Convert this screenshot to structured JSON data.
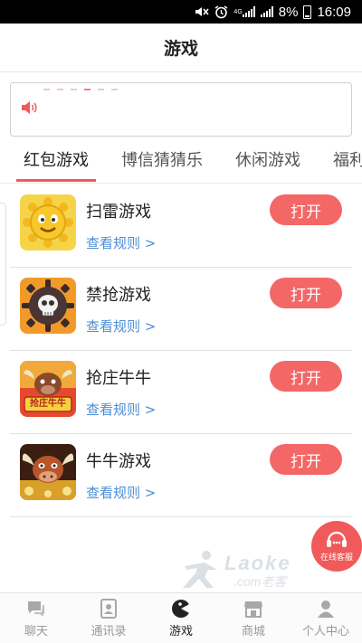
{
  "status_bar": {
    "network": "4G",
    "battery": "8%",
    "time": "16:09",
    "icons": [
      "mute-icon",
      "alarm-icon",
      "signal-icon",
      "signal-icon",
      "battery-icon"
    ]
  },
  "header": {
    "title": "游戏"
  },
  "notice": {
    "icon": "speaker-icon",
    "text": ""
  },
  "tabs": [
    {
      "label": "红包游戏",
      "active": true
    },
    {
      "label": "博信猜猜乐",
      "active": false
    },
    {
      "label": "休闲游戏",
      "active": false
    },
    {
      "label": "福利游戏",
      "active": false
    }
  ],
  "games": [
    {
      "name": "扫雷游戏",
      "rules": "查看规则 >",
      "button": "打开",
      "icon": "minesweeper-icon"
    },
    {
      "name": "禁抢游戏",
      "rules": "查看规则 >",
      "button": "打开",
      "icon": "skull-mine-icon"
    },
    {
      "name": "抢庄牛牛",
      "rules": "查看规则 >",
      "button": "打开",
      "icon": "bull-banker-icon",
      "icon_text": "抢庄牛牛"
    },
    {
      "name": "牛牛游戏",
      "rules": "查看规则 >",
      "button": "打开",
      "icon": "bull-game-icon"
    }
  ],
  "customer_service": {
    "label": "在线客服",
    "icon": "headset-icon"
  },
  "watermark": {
    "brand": "Laoke",
    "sub": ".com老客"
  },
  "bottom_nav": [
    {
      "label": "聊天",
      "icon": "chat-icon",
      "active": false
    },
    {
      "label": "通讯录",
      "icon": "contacts-icon",
      "active": false
    },
    {
      "label": "游戏",
      "icon": "game-icon",
      "active": true
    },
    {
      "label": "商城",
      "icon": "shop-icon",
      "active": false
    },
    {
      "label": "个人中心",
      "icon": "profile-icon",
      "active": false
    }
  ],
  "colors": {
    "accent": "#f46767",
    "tab_underline": "#f45a5a",
    "link": "#4b8ed6",
    "status_bar": "#000000"
  }
}
